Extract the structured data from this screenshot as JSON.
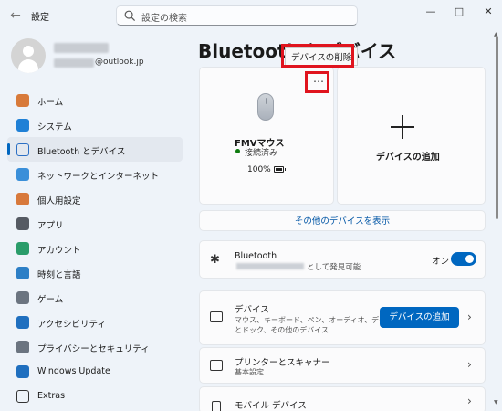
{
  "app": {
    "title": "設定"
  },
  "search": {
    "placeholder": "設定の検索"
  },
  "profile": {
    "email_suffix": "@outlook.jp"
  },
  "nav": {
    "items": [
      {
        "label": "ホーム",
        "icon": "home-icon",
        "color": "#d87a3a"
      },
      {
        "label": "システム",
        "icon": "system-icon",
        "color": "#1f80d6"
      },
      {
        "label": "Bluetooth とデバイス",
        "icon": "bluetooth-icon",
        "color": "#2b6fc4"
      },
      {
        "label": "ネットワークとインターネット",
        "icon": "wifi-icon",
        "color": "#3a8fd9"
      },
      {
        "label": "個人用設定",
        "icon": "brush-icon",
        "color": "#d8793c"
      },
      {
        "label": "アプリ",
        "icon": "apps-icon",
        "color": "#555a63"
      },
      {
        "label": "アカウント",
        "icon": "account-icon",
        "color": "#2a9c6a"
      },
      {
        "label": "時刻と言語",
        "icon": "clock-globe-icon",
        "color": "#2d7fc6"
      },
      {
        "label": "ゲーム",
        "icon": "gamepad-icon",
        "color": "#6b7480"
      },
      {
        "label": "アクセシビリティ",
        "icon": "accessibility-icon",
        "color": "#1f6fbf"
      },
      {
        "label": "プライバシーとセキュリティ",
        "icon": "shield-icon",
        "color": "#6b7480"
      },
      {
        "label": "Windows Update",
        "icon": "update-icon",
        "color": "#1f6fbf"
      },
      {
        "label": "Extras",
        "icon": "extras-icon",
        "color": "#333333"
      }
    ],
    "active_index": 2
  },
  "page": {
    "title": "Bluetooth とデバイス"
  },
  "tooltip": {
    "text": "デバイスの削除"
  },
  "device": {
    "name": "FMVマウス",
    "status": "接続済み",
    "battery": "100%",
    "battery_level": 1.0
  },
  "add_device_card": {
    "label": "デバイスの追加"
  },
  "show_more_link": "その他のデバイスを表示",
  "bluetooth": {
    "title": "Bluetooth",
    "subtitle": "として発見可能",
    "toggle_label": "オン",
    "on": true
  },
  "devices_row": {
    "title": "デバイス",
    "subtitle_line1": "マウス、キーボード、ペン、オーディオ、ディスプレイ",
    "subtitle_line2": "とドック、その他のデバイス",
    "button": "デバイスの追加"
  },
  "printers_row": {
    "title": "プリンターとスキャナー",
    "subtitle": "基本設定"
  },
  "mobile_row": {
    "title": "モバイル デバイス"
  },
  "colors": {
    "accent": "#0067c0",
    "highlight": "#e0141e"
  }
}
